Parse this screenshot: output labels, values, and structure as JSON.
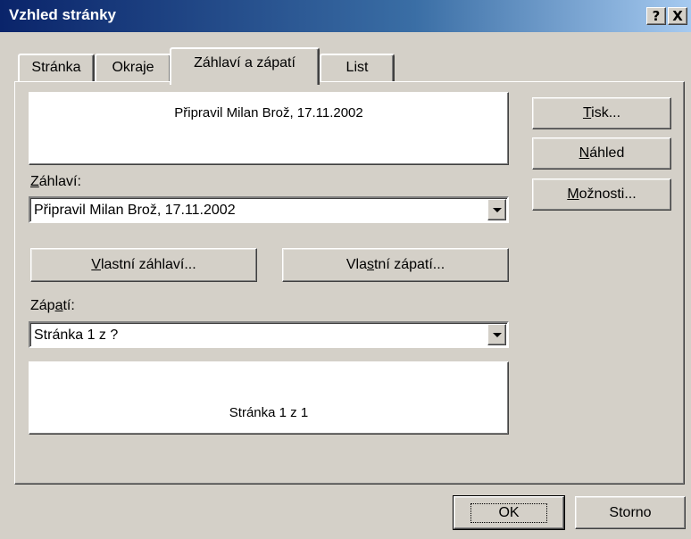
{
  "dialog": {
    "title": "Vzhled stránky",
    "help_button": "?",
    "close_button": "X"
  },
  "tabs": [
    {
      "label": "Stránka",
      "active": false
    },
    {
      "label": "Okraje",
      "active": false
    },
    {
      "label": "Záhlaví a zápatí",
      "active": true
    },
    {
      "label": "List",
      "active": false
    }
  ],
  "header": {
    "preview_text": "Připravil Milan Brož, 17.11.2002",
    "label_accel": "Z",
    "label_rest": "áhlaví:",
    "selected": "Připravil Milan Brož, 17.11.2002"
  },
  "custom_buttons": {
    "header_pre": "V",
    "header_rest": "lastní záhlaví...",
    "footer_pre": "Vla",
    "footer_accel": "s",
    "footer_rest": "tní zápatí..."
  },
  "footer": {
    "label_pre": "Záp",
    "label_accel": "a",
    "label_rest": "tí:",
    "selected": "Stránka 1 z ?",
    "preview_text": "Stránka 1 z 1"
  },
  "side_buttons": {
    "print_accel": "T",
    "print_rest": "isk...",
    "preview_accel": "N",
    "preview_rest": "áhled",
    "options_accel": "M",
    "options_rest": "ožnosti..."
  },
  "bottom_buttons": {
    "ok": "OK",
    "cancel": "Storno"
  }
}
